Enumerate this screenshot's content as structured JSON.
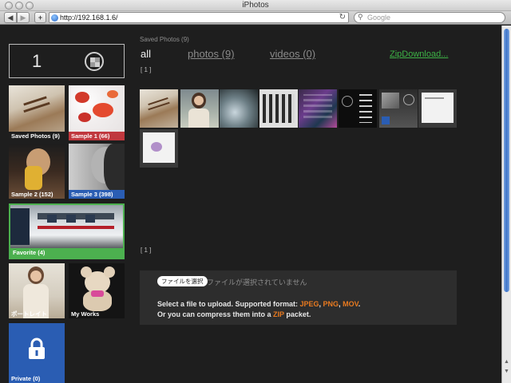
{
  "window": {
    "title": "iPhotos",
    "url": "http://192.168.1.6/",
    "search_placeholder": "Google"
  },
  "counter": {
    "value": "1"
  },
  "albums": [
    {
      "label": "Saved Photos (9)",
      "caption_color": "#1e1e1e"
    },
    {
      "label": "Sample 1 (66)",
      "caption_color": "#c0383e"
    },
    {
      "label": "Sample 2 (152)",
      "caption_color": "transparent"
    },
    {
      "label": "Sample 3 (398)",
      "caption_color": "#2a5db3"
    },
    {
      "label": "Favorite (4)",
      "caption_color": "#4cb04f"
    },
    {
      "label": "ポートレイト",
      "caption_color": "transparent"
    },
    {
      "label": "My Works",
      "caption_color": "transparent"
    },
    {
      "label": "Private (0)",
      "caption_color": "#2a5db3"
    }
  ],
  "main": {
    "section_title": "Saved Photos (9)",
    "tabs": [
      {
        "label": "all",
        "active": true
      },
      {
        "label": "photos (9)",
        "active": false
      },
      {
        "label": "videos (0)",
        "active": false
      }
    ],
    "zip_label": "ZipDownload...",
    "pager_top": "[ 1 ]",
    "pager_bottom": "[ 1 ]"
  },
  "upload": {
    "choose_label": "ファイルを選択",
    "no_file_label": "ファイルが選択されていません",
    "line1_prefix": "Select a file to upload. Supported format: ",
    "fmt_jpeg": "JPEG",
    "sep1": ", ",
    "fmt_png": "PNG",
    "sep2": ", ",
    "fmt_mov": "MOV",
    "line1_suffix": ".",
    "line2_prefix": "Or you can compress them into a ",
    "fmt_zip": "ZIP",
    "line2_suffix": " packet."
  },
  "colors": {
    "accent_green": "#4cb04f",
    "link_green": "#3db246",
    "format_orange": "#e97a1f",
    "album_red": "#c0383e",
    "album_blue": "#2a5db3"
  }
}
